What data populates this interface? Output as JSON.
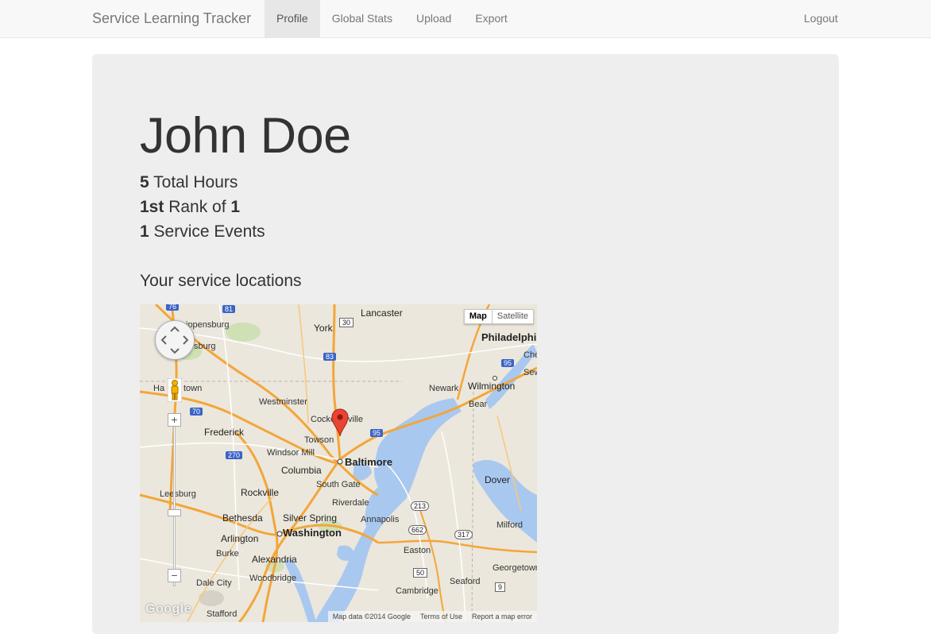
{
  "navbar": {
    "brand": "Service Learning Tracker",
    "items": [
      {
        "label": "Profile",
        "active": true
      },
      {
        "label": "Global Stats",
        "active": false
      },
      {
        "label": "Upload",
        "active": false
      },
      {
        "label": "Export",
        "active": false
      }
    ],
    "logout": "Logout"
  },
  "profile": {
    "name": "John Doe",
    "total_hours": {
      "value": "5",
      "label": "Total Hours"
    },
    "rank": {
      "value": "1st",
      "label": "Rank of",
      "of": "1"
    },
    "events": {
      "value": "1",
      "label": "Service Events"
    }
  },
  "locations": {
    "heading": "Your service locations",
    "map_type": {
      "map": "Map",
      "satellite": "Satellite"
    },
    "zoom": {
      "plus": "+",
      "minus": "−"
    },
    "logo": "Google",
    "attribution": [
      "Map data ©2014 Google",
      "Terms of Use",
      "Report a map error"
    ],
    "places": [
      {
        "name": "Lancaster",
        "size": "med"
      },
      {
        "name": "Philadelphi",
        "size": "big"
      },
      {
        "name": "ippensburg",
        "size": "sm"
      },
      {
        "name": "York",
        "size": "med"
      },
      {
        "name": "sburg",
        "size": "sm"
      },
      {
        "name": "Ha",
        "size": "sm"
      },
      {
        "name": "town",
        "size": "sm"
      },
      {
        "name": "Westminster",
        "size": "sm"
      },
      {
        "name": "Newark",
        "size": "sm"
      },
      {
        "name": "Wilmington",
        "size": "med"
      },
      {
        "name": "Bear",
        "size": "sm"
      },
      {
        "name": "Cocke",
        "size": "sm"
      },
      {
        "name": "ville",
        "size": "sm"
      },
      {
        "name": "Frederick",
        "size": "med"
      },
      {
        "name": "Towson",
        "size": "sm"
      },
      {
        "name": "Windsor Mill",
        "size": "sm"
      },
      {
        "name": "Baltimore",
        "size": "big"
      },
      {
        "name": "Columbia",
        "size": "med"
      },
      {
        "name": "South Gate",
        "size": "sm"
      },
      {
        "name": "Dover",
        "size": "med"
      },
      {
        "name": "Leesburg",
        "size": "sm"
      },
      {
        "name": "Rockville",
        "size": "med"
      },
      {
        "name": "Riverdale",
        "size": "sm"
      },
      {
        "name": "Bethesda",
        "size": "med"
      },
      {
        "name": "Silver Spring",
        "size": "med"
      },
      {
        "name": "Annapolis",
        "size": "sm"
      },
      {
        "name": "Milford",
        "size": "sm"
      },
      {
        "name": "Arlington",
        "size": "med"
      },
      {
        "name": "Washington",
        "size": "big"
      },
      {
        "name": "Burke",
        "size": "sm"
      },
      {
        "name": "Easton",
        "size": "sm"
      },
      {
        "name": "Alexandria",
        "size": "med"
      },
      {
        "name": "Georgetown",
        "size": "sm"
      },
      {
        "name": "Woodbridge",
        "size": "sm"
      },
      {
        "name": "Seaford",
        "size": "sm"
      },
      {
        "name": "Dale City",
        "size": "sm"
      },
      {
        "name": "Cambridge",
        "size": "sm"
      },
      {
        "name": "Stafford",
        "size": "sm"
      },
      {
        "name": "Sew",
        "size": "sm"
      },
      {
        "name": "Che",
        "size": "sm"
      }
    ],
    "routes": [
      "76",
      "81",
      "30",
      "83",
      "95",
      "70",
      "81",
      "270",
      "95",
      "213",
      "662",
      "317",
      "50",
      "9"
    ]
  }
}
